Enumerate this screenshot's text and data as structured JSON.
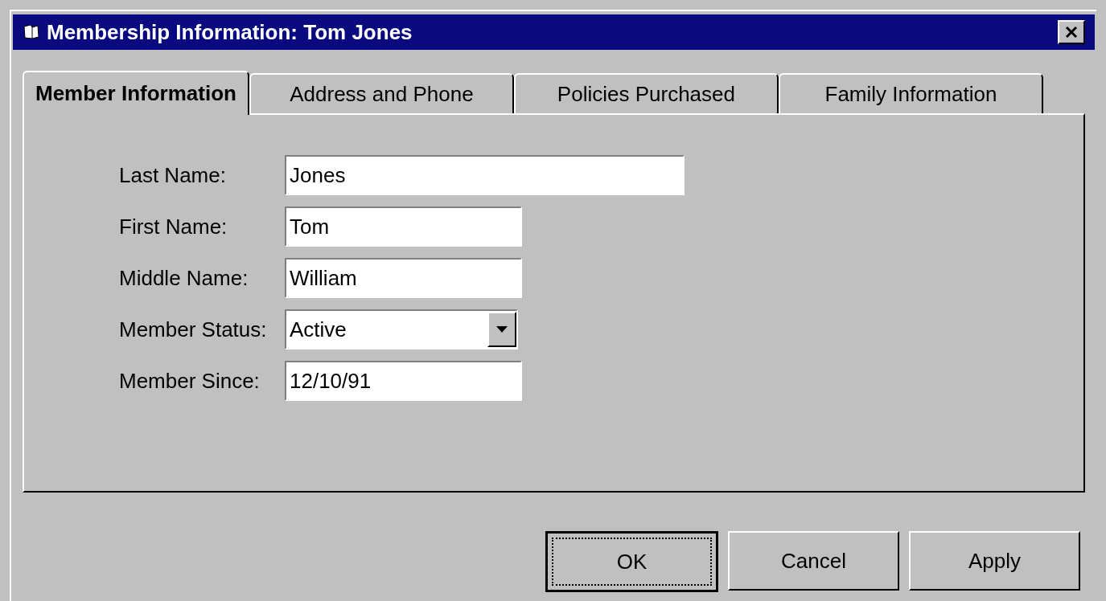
{
  "window": {
    "title": "Membership Information: Tom Jones"
  },
  "tabs": [
    {
      "label": "Member Information",
      "selected": true
    },
    {
      "label": "Address and Phone",
      "selected": false
    },
    {
      "label": "Policies Purchased",
      "selected": false
    },
    {
      "label": "Family Information",
      "selected": false
    }
  ],
  "fields": [
    {
      "label": "Last Name:",
      "value": "Jones",
      "kind": "long-text"
    },
    {
      "label": "First Name:",
      "value": "Tom",
      "kind": "text"
    },
    {
      "label": "Middle Name:",
      "value": "William",
      "kind": "text"
    },
    {
      "label": "Member Status:",
      "value": "Active",
      "kind": "dropdown"
    },
    {
      "label": "Member Since:",
      "value": "12/10/91",
      "kind": "text"
    }
  ],
  "buttons": [
    {
      "label": "OK",
      "default": true
    },
    {
      "label": "Cancel",
      "default": false
    },
    {
      "label": "Apply",
      "default": false
    }
  ]
}
